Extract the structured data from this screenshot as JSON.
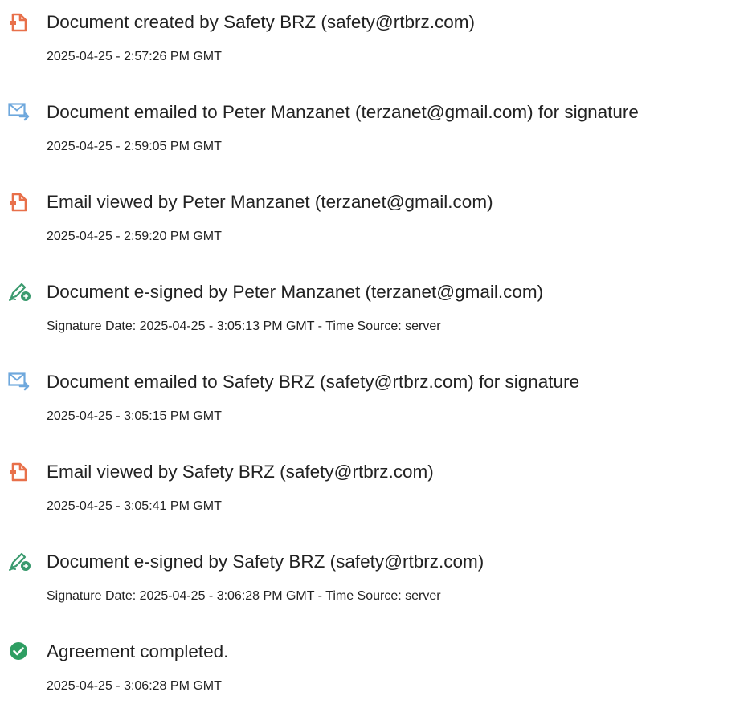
{
  "colors": {
    "document_icon": "#e8704a",
    "email_icon": "#6ea8dd",
    "esign_icon": "#3a9a6e",
    "completed_icon": "#2e9e62"
  },
  "events": [
    {
      "icon": "document-icon",
      "title": "Document created by Safety BRZ (safety@rtbrz.com)",
      "detail": "2025-04-25 - 2:57:26 PM GMT"
    },
    {
      "icon": "email-forward-icon",
      "title": "Document emailed to Peter Manzanet (terzanet@gmail.com) for signature",
      "detail": "2025-04-25 - 2:59:05 PM GMT"
    },
    {
      "icon": "document-icon",
      "title": "Email viewed by Peter Manzanet (terzanet@gmail.com)",
      "detail": "2025-04-25 - 2:59:20 PM GMT"
    },
    {
      "icon": "esign-pen-icon",
      "title": "Document e-signed by Peter Manzanet (terzanet@gmail.com)",
      "detail": "Signature Date: 2025-04-25 - 3:05:13 PM GMT - Time Source: server"
    },
    {
      "icon": "email-forward-icon",
      "title": "Document emailed to Safety BRZ (safety@rtbrz.com) for signature",
      "detail": "2025-04-25 - 3:05:15 PM GMT"
    },
    {
      "icon": "document-icon",
      "title": "Email viewed by Safety BRZ (safety@rtbrz.com)",
      "detail": "2025-04-25 - 3:05:41 PM GMT"
    },
    {
      "icon": "esign-pen-icon",
      "title": "Document e-signed by Safety BRZ (safety@rtbrz.com)",
      "detail": "Signature Date: 2025-04-25 - 3:06:28 PM GMT - Time Source: server"
    },
    {
      "icon": "checkmark-circle-icon",
      "title": "Agreement completed.",
      "detail": "2025-04-25 - 3:06:28 PM GMT"
    }
  ]
}
